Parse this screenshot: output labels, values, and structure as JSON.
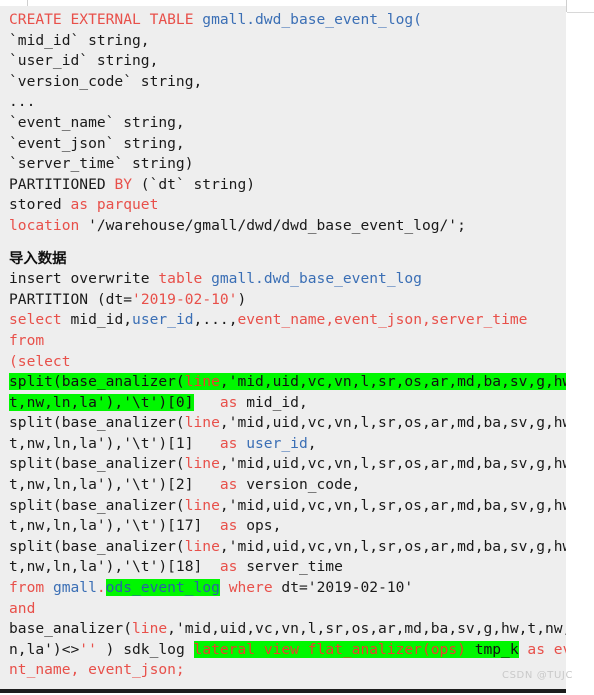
{
  "watermark": "CSDN @TUJC",
  "colors": {
    "code_background": "#eeeeee",
    "keyword_red": "#e8504a",
    "identifier_blue": "#3b6fb5",
    "highlight_green": "#00f700",
    "plain_text": "#000000",
    "watermark_gray": "#c9c9c9"
  },
  "code": {
    "section_heading": "导入数据",
    "lines": {
      "l1_a": "CREATE EXTERNAL TABLE ",
      "l1_b": "gmall",
      "l1_c": ".dwd_base_event_log(",
      "l2": "`mid_id` string,",
      "l3": "`user_id` string,",
      "l4": "`version_code` string,",
      "l5": "...",
      "l6": "`event_name` string,",
      "l7": "`event_json` string,",
      "l8": "`server_time` string)",
      "l9_a": "PARTITIONED ",
      "l9_b": "BY ",
      "l9_c": "(`dt` string)",
      "l10_a": "stored ",
      "l10_b": "as parquet",
      "l11_a": "location ",
      "l11_b": "'/warehouse/gmall/dwd/dwd_base_event_log/';",
      "l12_a": "insert overwrite ",
      "l12_b": "table ",
      "l12_c": "gmall",
      "l12_d": ".dwd_base_event_log",
      "l13_a": "PARTITION ",
      "l13_b": "(dt=",
      "l13_c": "'2019-02-10'",
      "l13_d": ")",
      "l14_a": "select ",
      "l14_b": "mid_id,",
      "l14_c": "user_id",
      "l14_d": ",...,",
      "l14_e": "event_name,event_json,server_time",
      "l15": "from",
      "l16": "(select",
      "l17_hl_a": "split(base_analizer(",
      "l17_hl_b": "line",
      "l17_hl_c": ",'mid,uid,vc,vn,l,sr,os,ar,md,ba,sv,g,hw,",
      "l18_hl_a": "t,nw,ln,la'),'\\t')[0]",
      "l18_b": "   as ",
      "l18_c": "mid_id,",
      "l19_a": "split(base_analizer(",
      "l19_b": "line",
      "l19_c": ",'mid,uid,vc,vn,l,sr,os,ar,md,ba,sv,g,hw,",
      "l20_a": "t,nw,ln,la'),'\\t')[1]",
      "l20_b": "   as ",
      "l20_c": "user_id",
      "l20_d": ",",
      "l21_a": "split(base_analizer(",
      "l21_b": "line",
      "l21_c": ",'mid,uid,vc,vn,l,sr,os,ar,md,ba,sv,g,hw,",
      "l22_a": "t,nw,ln,la'),'\\t')[2]",
      "l22_b": "   as ",
      "l22_c": "version_code,",
      "l23_a": "split(base_analizer(",
      "l23_b": "line",
      "l23_c": ",'mid,uid,vc,vn,l,sr,os,ar,md,ba,sv,g,hw,",
      "l24_a": "t,nw,ln,la'),'\\t')[17]",
      "l24_b": "  as ",
      "l24_c": "ops,",
      "l25_a": "split(base_analizer(",
      "l25_b": "line",
      "l25_c": ",'mid,uid,vc,vn,l,sr,os,ar,md,ba,sv,g,hw,",
      "l26_a": "t,nw,ln,la'),'\\t')[18]",
      "l26_b": "  as ",
      "l26_c": "server_time",
      "l27_a": "from ",
      "l27_b": "gmall",
      "l27_c": ".",
      "l27_d": "ods_event_log",
      "l27_e": " where ",
      "l27_f": "dt=",
      "l27_g": "'2019-02-10'",
      "l28": "and",
      "l29_a": "base_analizer(",
      "l29_b": "line",
      "l29_c": ",'mid,uid,vc,vn,l,sr,os,ar,md,ba,sv,g,hw,t,nw,l",
      "l30_a": "n,la')<>",
      "l30_b": "''",
      "l30_c": " ) sdk_log ",
      "l30_d": "lateral view flat_analizer(ops) ",
      "l30_e": "tmp_k",
      "l30_f": " as eve",
      "l31_a": "nt_name, event_json;"
    }
  }
}
